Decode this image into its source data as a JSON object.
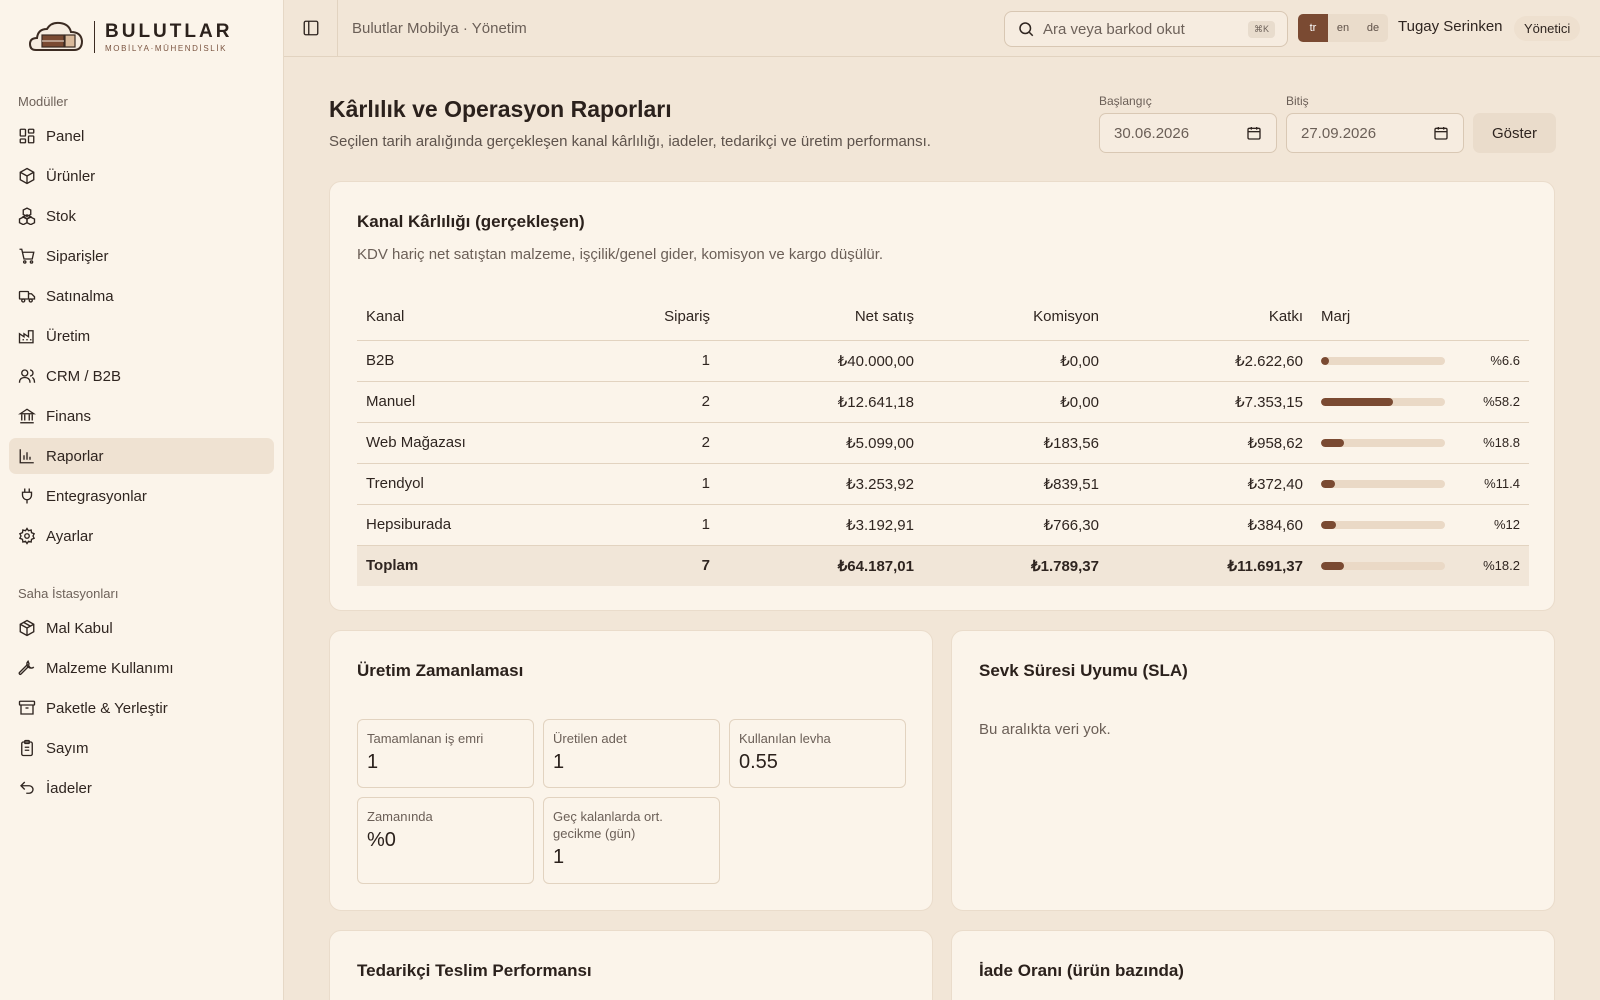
{
  "brand": {
    "name": "BULUTLAR",
    "sub": "MOBİLYA·MÜHENDİSLİK"
  },
  "sidebar": {
    "modules_label": "Modüller",
    "items": [
      {
        "label": "Panel",
        "icon": "grid-icon"
      },
      {
        "label": "Ürünler",
        "icon": "box-icon"
      },
      {
        "label": "Stok",
        "icon": "boxes-icon"
      },
      {
        "label": "Siparişler",
        "icon": "cart-icon"
      },
      {
        "label": "Satınalma",
        "icon": "truck-icon"
      },
      {
        "label": "Üretim",
        "icon": "factory-icon"
      },
      {
        "label": "CRM / B2B",
        "icon": "users-icon"
      },
      {
        "label": "Finans",
        "icon": "bank-icon"
      },
      {
        "label": "Raporlar",
        "icon": "bar-chart-icon",
        "active": true
      },
      {
        "label": "Entegrasyonlar",
        "icon": "plug-icon"
      },
      {
        "label": "Ayarlar",
        "icon": "gear-icon"
      }
    ],
    "stations_label": "Saha İstasyonları",
    "stations": [
      {
        "label": "Mal Kabul",
        "icon": "package-icon"
      },
      {
        "label": "Malzeme Kullanımı",
        "icon": "wrench-icon"
      },
      {
        "label": "Paketle & Yerleştir",
        "icon": "archive-icon"
      },
      {
        "label": "Sayım",
        "icon": "clipboard-icon"
      },
      {
        "label": "İadeler",
        "icon": "undo-icon"
      }
    ]
  },
  "topbar": {
    "breadcrumb": "Bulutlar Mobilya · Yönetim",
    "search_placeholder": "Ara veya barkod okut",
    "shortcut": "⌘K",
    "languages": [
      "tr",
      "en",
      "de"
    ],
    "active_language": "tr",
    "user": "Tugay Serinken",
    "role": "Yönetici"
  },
  "page": {
    "title": "Kârlılık ve Operasyon Raporları",
    "subtitle": "Seçilen tarih aralığında gerçekleşen kanal kârlılığı, iadeler, tedarikçi ve üretim performansı.",
    "start_label": "Başlangıç",
    "start_value": "30.06.2026",
    "end_label": "Bitiş",
    "end_value": "27.09.2026",
    "show_button": "Göster"
  },
  "channel_card": {
    "title": "Kanal Kârlılığı (gerçekleşen)",
    "subtitle": "KDV hariç net satıştan malzeme, işçilik/genel gider, komisyon ve kargo düşülür.",
    "columns": [
      "Kanal",
      "Sipariş",
      "Net satış",
      "Komisyon",
      "Katkı",
      "Marj"
    ],
    "rows": [
      {
        "channel": "B2B",
        "orders": "1",
        "net": "₺40.000,00",
        "commission": "₺0,00",
        "contribution": "₺2.622,60",
        "margin": "%6.6",
        "margin_value": 6.6
      },
      {
        "channel": "Manuel",
        "orders": "2",
        "net": "₺12.641,18",
        "commission": "₺0,00",
        "contribution": "₺7.353,15",
        "margin": "%58.2",
        "margin_value": 58.2
      },
      {
        "channel": "Web Mağazası",
        "orders": "2",
        "net": "₺5.099,00",
        "commission": "₺183,56",
        "contribution": "₺958,62",
        "margin": "%18.8",
        "margin_value": 18.8
      },
      {
        "channel": "Trendyol",
        "orders": "1",
        "net": "₺3.253,92",
        "commission": "₺839,51",
        "contribution": "₺372,40",
        "margin": "%11.4",
        "margin_value": 11.4
      },
      {
        "channel": "Hepsiburada",
        "orders": "1",
        "net": "₺3.192,91",
        "commission": "₺766,30",
        "contribution": "₺384,60",
        "margin": "%12",
        "margin_value": 12
      }
    ],
    "total": {
      "channel": "Toplam",
      "orders": "7",
      "net": "₺64.187,01",
      "commission": "₺1.789,37",
      "contribution": "₺11.691,37",
      "margin": "%18.2",
      "margin_value": 18.2
    }
  },
  "production_card": {
    "title": "Üretim Zamanlaması",
    "stats": [
      {
        "label": "Tamamlanan iş emri",
        "value": "1"
      },
      {
        "label": "Üretilen adet",
        "value": "1"
      },
      {
        "label": "Kullanılan levha",
        "value": "0.55"
      },
      {
        "label": "Zamanında",
        "value": "%0"
      },
      {
        "label": "Geç kalanlarda ort. gecikme (gün)",
        "value": "1"
      }
    ]
  },
  "sla_card": {
    "title": "Sevk Süresi Uyumu (SLA)",
    "empty": "Bu aralıkta veri yok."
  },
  "supplier_card": {
    "title": "Tedarikçi Teslim Performansı"
  },
  "returns_card": {
    "title": "İade Oranı (ürün bazında)"
  },
  "colors": {
    "accent": "#7a4a32",
    "background": "#f2e6d7",
    "sidebar": "#fbf4ea"
  }
}
